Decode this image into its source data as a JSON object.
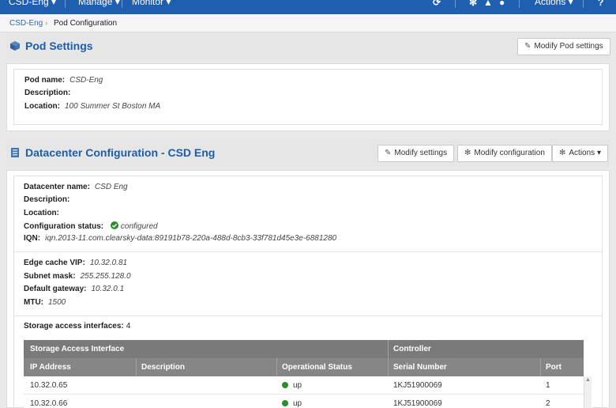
{
  "topnav": {
    "brand": "CSD-Eng ▾",
    "manage": "Manage ▾",
    "monitor": "Monitor ▾",
    "actions": "Actions ▾",
    "help": "?"
  },
  "breadcrumb": {
    "root": "CSD-Eng",
    "current": "Pod Configuration"
  },
  "pod_settings": {
    "title": "Pod Settings",
    "modify_button": "Modify Pod settings",
    "fields": {
      "name_label": "Pod name:",
      "name_value": "CSD-Eng",
      "description_label": "Description:",
      "description_value": "",
      "location_label": "Location:",
      "location_value": "100 Summer St Boston MA"
    }
  },
  "datacenter": {
    "title": "Datacenter Configuration - CSD Eng",
    "modify_settings_button": "Modify settings",
    "modify_configuration_button": "Modify configuration",
    "actions_button": "Actions ▾",
    "fields": {
      "name_label": "Datacenter name:",
      "name_value": "CSD Eng",
      "description_label": "Description:",
      "location_label": "Location:",
      "config_status_label": "Configuration status:",
      "config_status_value": "configured",
      "iqn_label": "IQN:",
      "iqn_value": "iqn.2013-11.com.clearsky-data:89191b78-220a-488d-8cb3-33f781d45e3e-6881280"
    },
    "network": {
      "vip_label": "Edge cache VIP:",
      "vip_value": "10.32.0.81",
      "subnet_label": "Subnet mask:",
      "subnet_value": "255.255.128.0",
      "gateway_label": "Default gateway:",
      "gateway_value": "10.32.0.1",
      "mtu_label": "MTU:",
      "mtu_value": "1500"
    },
    "storage": {
      "count_label": "Storage access interfaces:",
      "count_value": "4",
      "group_headers": {
        "left": "Storage Access Interface",
        "right": "Controller"
      },
      "columns": [
        "IP Address",
        "Description",
        "Operational Status",
        "Serial Number",
        "Port"
      ],
      "rows": [
        {
          "ip": "10.32.0.65",
          "description": "",
          "status": "up",
          "serial": "1KJ51900069",
          "port": "1"
        },
        {
          "ip": "10.32.0.66",
          "description": "",
          "status": "up",
          "serial": "1KJ51900069",
          "port": "2"
        }
      ]
    }
  },
  "colors": {
    "nav": "#1f5fb0",
    "title": "#1d5ea8",
    "status_ok": "#2e8b2e"
  }
}
